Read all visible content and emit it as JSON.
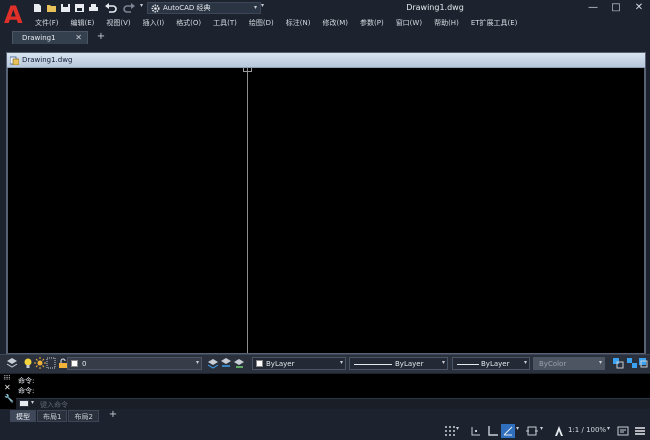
{
  "app": {
    "logo_letter": "A",
    "workspace": "AutoCAD 经典",
    "title": "Drawing1.dwg"
  },
  "window_controls": {
    "minimize": "—",
    "restore": "□",
    "close": "✕"
  },
  "menu": [
    "文件(F)",
    "编辑(E)",
    "视图(V)",
    "插入(I)",
    "格式(O)",
    "工具(T)",
    "绘图(D)",
    "标注(N)",
    "修改(M)",
    "参数(P)",
    "窗口(W)",
    "帮助(H)",
    "ET扩展工具(E)"
  ],
  "file_tabs": [
    {
      "label": "Drawing1",
      "close": "✕"
    }
  ],
  "file_tab_add": "+",
  "drawing_window": {
    "title": "Drawing1.dwg"
  },
  "properties": {
    "layer": "0",
    "color": "ByLayer",
    "linetype": "ByLayer",
    "lineweight": "ByLayer",
    "plotstyle": "ByColor"
  },
  "command": {
    "history": [
      "命令:",
      "命令:"
    ],
    "placeholder": "键入命令"
  },
  "layout_tabs": [
    "模型",
    "布局1",
    "布局2"
  ],
  "layout_tab_add": "+",
  "status": {
    "annotation_scale": "1:1 / 100%"
  },
  "colors": {
    "background": "#1c232e",
    "canvas": "#000000",
    "logo": "#e0302a",
    "drawing_title_bg": "#c8d6e8"
  }
}
